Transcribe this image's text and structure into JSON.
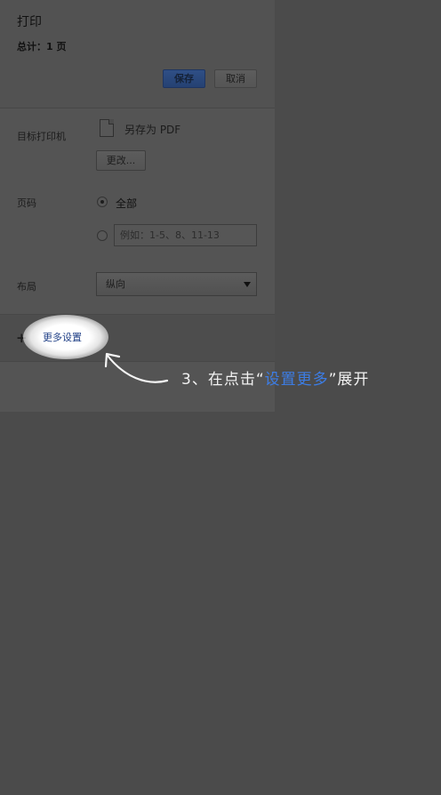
{
  "header": {
    "title": "打印",
    "total": "总计：1 页"
  },
  "actions": {
    "save_label": "保存",
    "cancel_label": "取消"
  },
  "destination": {
    "label": "目标打印机",
    "value": "另存为 PDF",
    "change_label": "更改..."
  },
  "pages": {
    "label": "页码",
    "all_label": "全部",
    "custom_placeholder": "例如：1-5、8、11-13",
    "selected": "全部"
  },
  "layout": {
    "label": "布局",
    "selected": "纵向"
  },
  "more_settings": {
    "label": "更多设置"
  },
  "annotation": {
    "prefix": "3、在点击“",
    "highlight": "设置更多",
    "suffix": "”展开",
    "highlight_color": "#3c7de6"
  },
  "icons": {
    "document": "pdf-document-icon",
    "expand": "plus-icon",
    "dropdown": "chevron-down-icon",
    "pointer": "curved-arrow-icon"
  }
}
